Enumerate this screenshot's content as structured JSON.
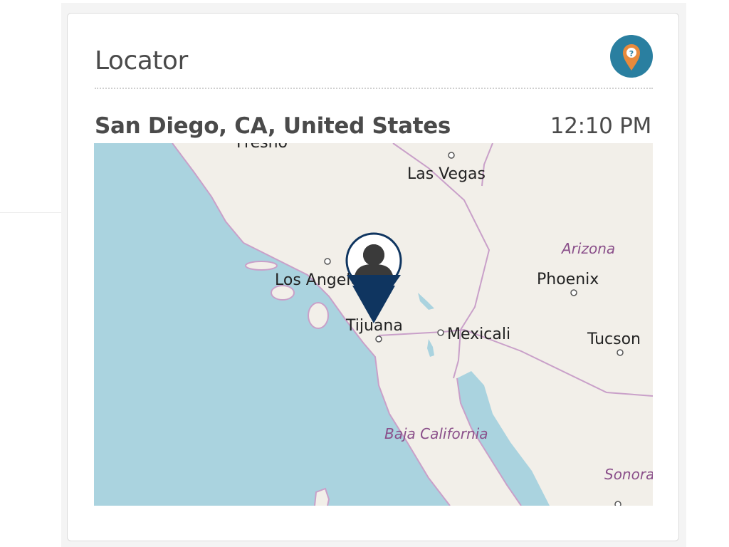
{
  "widget": {
    "title": "Locator",
    "icon": "map-pin-help-icon"
  },
  "location": {
    "name": "San Diego, CA, United States",
    "time": "12:10 PM"
  },
  "map": {
    "marker": "user-location-pin-icon",
    "colors": {
      "water": "#aad3df",
      "land": "#f2efe9",
      "border": "#c9a0c9",
      "pin": "#0f3560"
    },
    "labels": {
      "fresno": "Fresno",
      "las_vegas": "Las Vegas",
      "arizona": "Arizona",
      "phoenix": "Phoenix",
      "los_angeles": "Los Angeles",
      "tijuana": "Tijuana",
      "mexicali": "Mexicali",
      "tucson": "Tucson",
      "baja_california": "Baja California",
      "sonora": "Sonora"
    }
  }
}
